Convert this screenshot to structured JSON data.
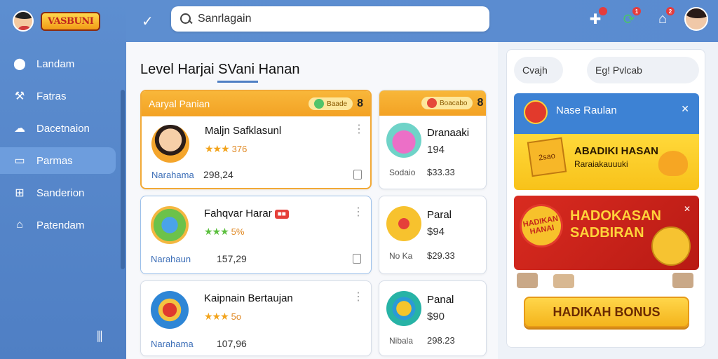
{
  "sidebar": {
    "logo_text": "VASBUNI",
    "items": [
      {
        "label": "Landam",
        "icon": "globe-icon"
      },
      {
        "label": "Fatras",
        "icon": "hammer-icon"
      },
      {
        "label": "Dacetnaion",
        "icon": "cloud-icon"
      },
      {
        "label": "Parmas",
        "icon": "window-icon",
        "active": true
      },
      {
        "label": "Sanderion",
        "icon": "grid-icon"
      },
      {
        "label": "Patendam",
        "icon": "home-icon"
      }
    ],
    "footer_icon": "filter-icon"
  },
  "topbar": {
    "search_value": "Sanrlagain",
    "notif_counts": [
      "1",
      "2"
    ]
  },
  "main": {
    "title": "Level Harjai SVani Hanan",
    "featured": {
      "header": "Aaryal Panian",
      "pill": "Baade",
      "count": "8",
      "items": [
        {
          "title": "Maljn Safklasunl",
          "rating": "3/5",
          "rating_text": "376",
          "foot_left": "Narahama",
          "foot_mid": "298,24"
        },
        {
          "title": "Fahqvar Harar",
          "tag": "■■",
          "rating_text": "5%",
          "foot_left": "Narahaun",
          "foot_mid": "157,29"
        },
        {
          "title": "Kaipnain Bertaujan",
          "rating_text": "5o",
          "foot_left": "Narahama",
          "foot_mid": "107,96"
        }
      ]
    },
    "side_cards": {
      "header_pill": "Boacabo",
      "count": "8",
      "items": [
        {
          "title": "Dranaaki",
          "price": "194",
          "foot_left": "Sodaio",
          "foot_right": "$33.33"
        },
        {
          "title": "Paral",
          "price": "$94",
          "foot_left": "No Ka",
          "foot_right": "$29.33"
        },
        {
          "title": "Panal",
          "price": "$90",
          "foot_left": "Nibala",
          "foot_right": "298.23"
        }
      ]
    }
  },
  "right_panel": {
    "pill_left": "Cvajh",
    "pill_right": "Eg! Pvlcab",
    "promo1_title": "Nase Raulan",
    "promo1_line1": "ABADIKI HASAN",
    "promo1_line2": "Raraiakauuuki",
    "promo1_tag": "2sao",
    "promo2_badge_1": "HADIKAN",
    "promo2_badge_2": "HANAI",
    "promo2_line1": "HADOKASAN",
    "promo2_line2": "SADBIRAN",
    "bonus_button": "HADIKAH BONUS"
  },
  "colors": {
    "accent_blue": "#4f7fc4",
    "accent_orange": "#f3a224",
    "promo_red": "#d92b20"
  }
}
